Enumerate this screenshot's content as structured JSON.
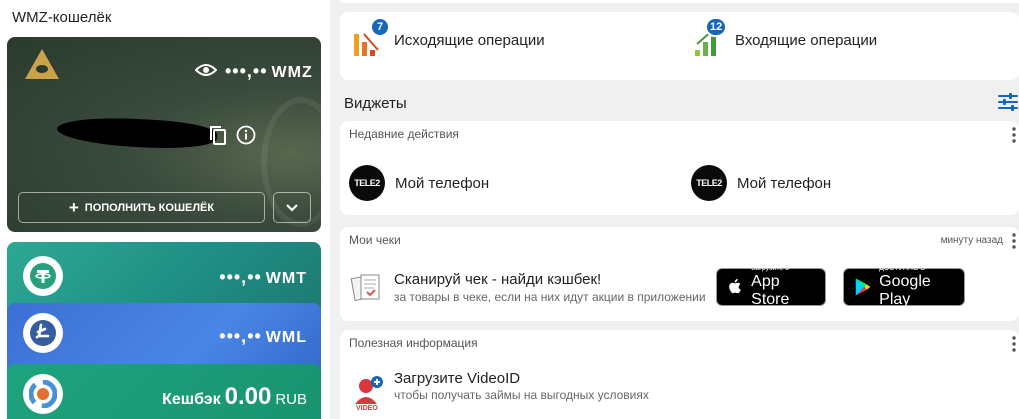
{
  "wallet": {
    "title": "WMZ-кошелёк",
    "main_card": {
      "balance_mask": "•••,••",
      "currency": "WMZ",
      "topup_label": "ПОПОЛНИТЬ КОШЕЛЁК",
      "icons": [
        "pyramid-icon",
        "eye-icon",
        "copy-icon",
        "info-icon",
        "chevron-down-icon"
      ]
    },
    "sub_cards": [
      {
        "balance_mask": "•••,••",
        "currency": "WMT",
        "icon": "tether-icon",
        "color": "#2da893"
      },
      {
        "balance_mask": "•••,••",
        "currency": "WML",
        "icon": "litecoin-icon",
        "color": "#4a86e6"
      }
    ],
    "cashback": {
      "label": "Кешбэк",
      "amount": "0.00",
      "currency": "RUB",
      "color": "#1ea37d"
    }
  },
  "operations": {
    "outgoing": {
      "label": "Исходящие операции",
      "count": "7"
    },
    "incoming": {
      "label": "Входящие операции",
      "count": "12"
    }
  },
  "widgets": {
    "title": "Виджеты",
    "recent": {
      "header": "Недавние действия",
      "items": [
        {
          "logo": "TELE2",
          "label": "Мой телефон"
        },
        {
          "logo": "TELE2",
          "label": "Мой телефон"
        }
      ]
    },
    "receipts": {
      "header": "Мои чеки",
      "time_ago": "минуту назад",
      "title": "Сканируй чек - найди кэшбек!",
      "subtitle": "за товары в чеке, если на них идут акции в приложении",
      "appstore": {
        "small": "Загрузите в",
        "big": "App Store"
      },
      "gplay": {
        "small": "ДОСТУПНО В",
        "big": "Google Play"
      }
    },
    "info": {
      "header": "Полезная информация",
      "title": "Загрузите VideoID",
      "subtitle": "чтобы получать займы на выгодных условиях",
      "icon_label": "VIDEO"
    }
  },
  "colors": {
    "accent": "#1766b8",
    "outgoing_bar": "#f0a020",
    "incoming_bar": "#5cb85c"
  }
}
